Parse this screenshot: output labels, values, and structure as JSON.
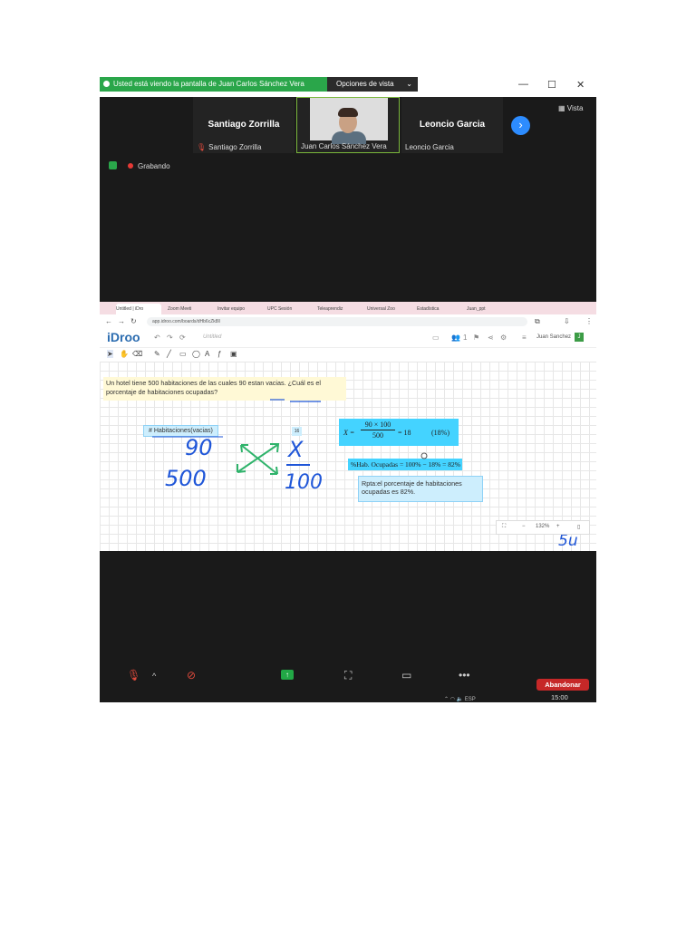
{
  "zoom": {
    "banner_text": "Usted está viendo la pantalla de Juan Carlos Sánchez Vera",
    "view_options": "Opciones de vista",
    "window_controls": {
      "minimize": "—",
      "maximize": "☐",
      "close": "✕"
    },
    "view_label": "Vista",
    "participants": [
      {
        "big_name": "Santiago Zorrilla",
        "small_name": "Santiago Zorrilla",
        "muted": true
      },
      {
        "big_name": "",
        "small_name": "Juan Carlos Sánchez Vera",
        "muted": false,
        "video": true
      },
      {
        "big_name": "Leoncio Garcia",
        "small_name": "Leoncio Garcia",
        "muted": false
      }
    ],
    "recording_label": "Grabando",
    "leave_button": "Abandonar",
    "clock": "15:00",
    "taskbar_lang": "ESP"
  },
  "browser": {
    "tabs": [
      "Untitled | iDro",
      "Zoom Meeti",
      "Invitar equipo",
      "UPC Sesión",
      "Teleaprendiz",
      "Universal Zoo",
      "Estadística",
      "Juan_ppt"
    ],
    "url": "app.idroo.com/boards/dHb6cZk8ll"
  },
  "idroo": {
    "logo": "iDroo",
    "doc_name": "Untitled",
    "users_count": "1",
    "user_name": "Juan Sanchez",
    "user_initial": "J",
    "problem_text_1": "Un hotel tiene 500 habitaciones de las cuales 90 estan vacias. ¿Cuál es el",
    "problem_text_2": "porcentaje de habitaciones ocupadas?",
    "tag_habitaciones": "# Habitaciones(vacias)",
    "tag_16": "16",
    "formula": {
      "lhs": "X =",
      "numerator": "90 × 100",
      "denominator": "500",
      "rhs": "= 18",
      "pct": "(18%)"
    },
    "hab_ocupadas": "%Hab. Ocupadas = 100% − 18% = 82%",
    "answer": "Rpta:el porcentaje de habitaciones ocupadas es 82%.",
    "zoom_level": "132%",
    "handwriting": [
      "90",
      "500",
      "X",
      "100",
      "5u"
    ]
  },
  "colors": {
    "zoom_green": "#2aa64a",
    "zoom_blue": "#2d8cff",
    "ink_blue": "#1f56d8",
    "ink_green": "#2fb36b",
    "leave_red": "#c62828"
  }
}
